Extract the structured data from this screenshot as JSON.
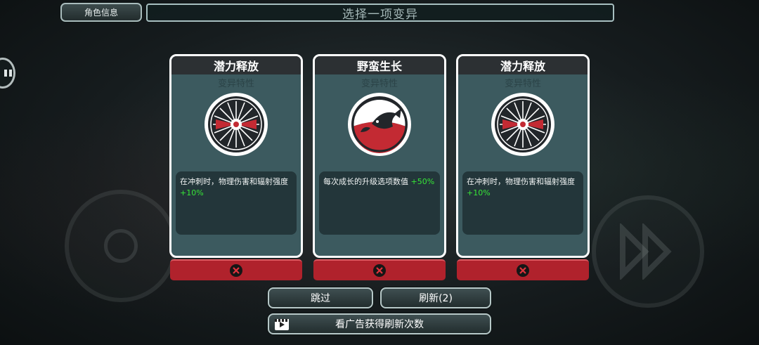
{
  "header": {
    "char_info_label": "角色信息",
    "title": "选择一项变异"
  },
  "cards": [
    {
      "name": "潜力释放",
      "type": "变异特性",
      "icon": "radial-burst-icon",
      "desc": "在冲刺时，物理伤害和辐射强度",
      "bonus": "+10%"
    },
    {
      "name": "野蛮生长",
      "type": "变异特性",
      "icon": "fish-yin-yang-icon",
      "desc": "每次成长的升级选项数值",
      "bonus": "+50%"
    },
    {
      "name": "潜力释放",
      "type": "变异特性",
      "icon": "radial-burst-icon",
      "desc": "在冲刺时，物理伤害和辐射强度",
      "bonus": "+10%"
    }
  ],
  "buttons": {
    "skip": "跳过",
    "refresh": "刷新(2)",
    "watch_ad": "看广告获得刷新次数"
  },
  "colors": {
    "card_bg": "#3c5a5f",
    "skip_red": "#b0222c",
    "bonus_green": "#37e637"
  }
}
